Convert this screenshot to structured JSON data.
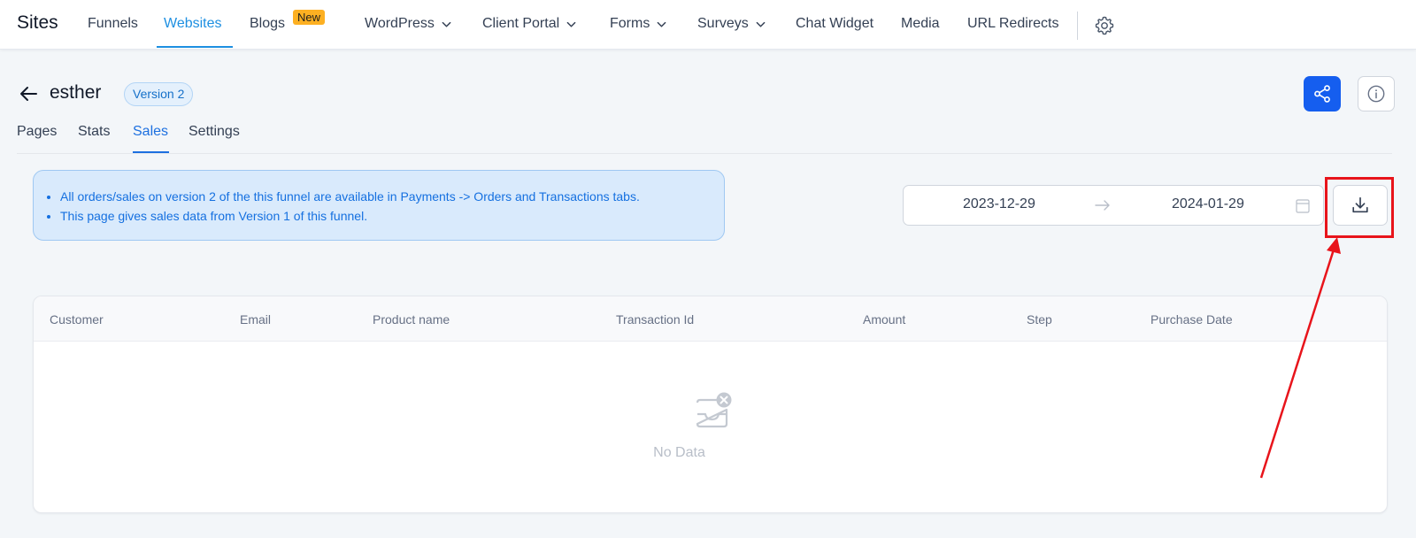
{
  "topnav": {
    "brand": "Sites",
    "items": [
      {
        "label": "Funnels"
      },
      {
        "label": "Websites"
      },
      {
        "label": "Blogs"
      },
      {
        "label": "WordPress"
      },
      {
        "label": "Client Portal"
      },
      {
        "label": "Forms"
      },
      {
        "label": "Surveys"
      },
      {
        "label": "Chat Widget"
      },
      {
        "label": "Media"
      },
      {
        "label": "URL Redirects"
      }
    ],
    "new_badge": "New",
    "active_item": "Websites"
  },
  "header": {
    "title": "esther",
    "version_badge": "Version 2"
  },
  "tabs": {
    "items": [
      {
        "label": "Pages"
      },
      {
        "label": "Stats"
      },
      {
        "label": "Sales"
      },
      {
        "label": "Settings"
      }
    ],
    "active": "Sales"
  },
  "info_box": {
    "lines": [
      "All orders/sales on version 2 of the this funnel are available in Payments -> Orders and Transactions tabs.",
      "This page gives sales data from Version 1 of this funnel."
    ]
  },
  "date_range": {
    "start": "2023-12-29",
    "end": "2024-01-29"
  },
  "table": {
    "columns": [
      {
        "label": "Customer"
      },
      {
        "label": "Email"
      },
      {
        "label": "Product name"
      },
      {
        "label": "Transaction Id"
      },
      {
        "label": "Amount"
      },
      {
        "label": "Step"
      },
      {
        "label": "Purchase Date"
      }
    ],
    "rows": [],
    "empty_text": "No Data"
  },
  "colors": {
    "primary": "#155eef",
    "link_active": "#1d8fe1",
    "annotation": "#e8141b",
    "badge_new": "#fdb022"
  }
}
